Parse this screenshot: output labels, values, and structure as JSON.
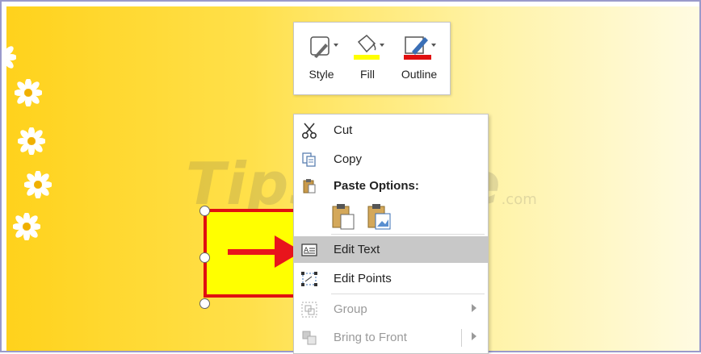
{
  "mini_toolbar": {
    "style_label": "Style",
    "fill_label": "Fill",
    "outline_label": "Outline",
    "fill_color": "#ffff00",
    "outline_color": "#e01010"
  },
  "watermark": {
    "main": "TipsMake",
    "suffix": ".com"
  },
  "context_menu": {
    "cut": "Cut",
    "copy": "Copy",
    "paste_options": "Paste Options:",
    "edit_text": "Edit Text",
    "edit_points": "Edit Points",
    "group": "Group",
    "bring_to_front": "Bring to Front"
  },
  "icons": {
    "cut": "scissors-icon",
    "copy": "copy-icon",
    "paste": "clipboard-icon",
    "edit_text": "edit-text-icon",
    "edit_points": "edit-points-icon",
    "group": "group-icon",
    "bring_to_front": "bring-to-front-icon"
  },
  "colors": {
    "slide_gradient_start": "#ffd21c",
    "slide_gradient_end": "#fffbe2",
    "shape_fill": "#ffff00",
    "shape_border": "#e01010",
    "arrow": "#e8141c",
    "menu_highlight": "#c8c8c8"
  }
}
